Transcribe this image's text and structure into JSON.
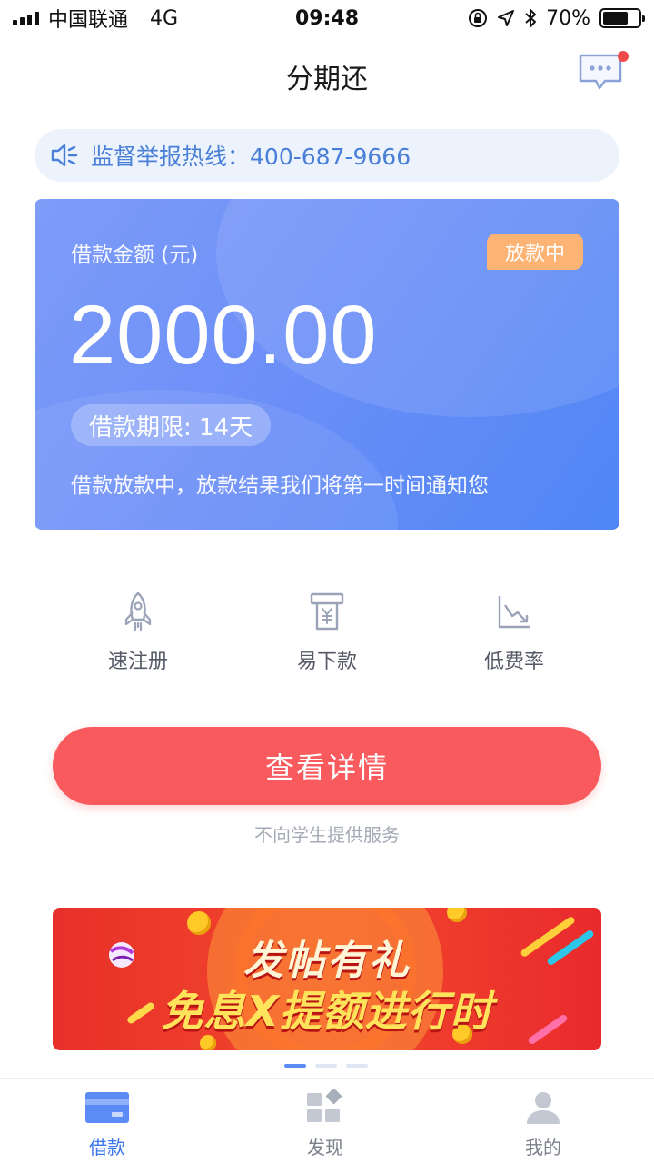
{
  "status_bar": {
    "carrier": "中国联通",
    "network": "4G",
    "time": "09:48",
    "battery": "70%",
    "battery_level": 0.7
  },
  "header": {
    "title": "分期还",
    "message_icon": "chat-bubble-icon",
    "has_unread": true
  },
  "hotline": {
    "icon": "speaker-icon",
    "label": "监督举报热线：",
    "phone": "400-687-9666"
  },
  "loan_card": {
    "amount_label": "借款金额 (元)",
    "status": "放款中",
    "amount": "2000.00",
    "term": "借款期限: 14天",
    "note": "借款放款中，放款结果我们将第一时间通知您"
  },
  "features": [
    {
      "icon": "rocket-icon",
      "label": "速注册"
    },
    {
      "icon": "atm-yen-icon",
      "label": "易下款"
    },
    {
      "icon": "trend-down-chart-icon",
      "label": "低费率"
    }
  ],
  "cta": {
    "label": "查看详情"
  },
  "disclaimer": "不向学生提供服务",
  "banner": {
    "line1": "发帖有礼",
    "line2": "免息X提额进行时",
    "slide_count": 3,
    "active_slide": 1
  },
  "tab_bar": {
    "tabs": [
      {
        "icon": "card-icon",
        "label": "借款",
        "active": true
      },
      {
        "icon": "discover-grid-icon",
        "label": "发现",
        "active": false
      },
      {
        "icon": "user-icon",
        "label": "我的",
        "active": false
      }
    ]
  },
  "colors": {
    "accent_blue": "#4f86f5",
    "cta_red": "#f85a5d",
    "badge_orange": "#fdb373",
    "hotline_text": "#4a7fd8"
  }
}
